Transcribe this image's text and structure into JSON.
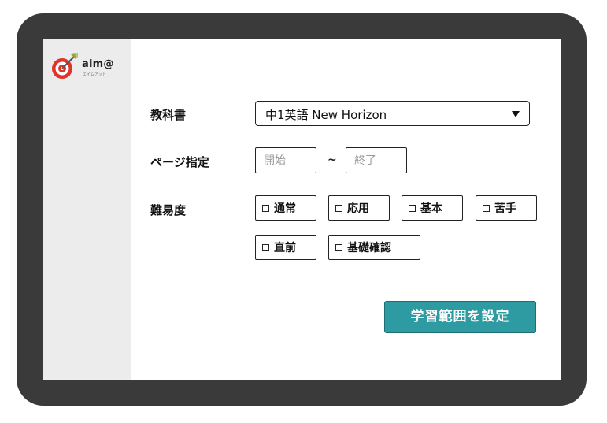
{
  "brand": {
    "name": "aim@",
    "subtitle": "エイムアット",
    "accent_color": "#e2322a",
    "logo_icon": "target-arrow-icon"
  },
  "form": {
    "textbook": {
      "label": "教科書",
      "selected": "中1英語 New Horizon",
      "icon": "dropdown-arrow-icon"
    },
    "pages": {
      "label": "ページ指定",
      "start_placeholder": "開始",
      "separator": "~",
      "end_placeholder": "終了"
    },
    "difficulty": {
      "label": "難易度",
      "options": [
        {
          "label": "通常"
        },
        {
          "label": "応用"
        },
        {
          "label": "基本"
        },
        {
          "label": "苦手"
        },
        {
          "label": "直前"
        },
        {
          "label": "基礎確認"
        }
      ]
    },
    "submit": {
      "label": "学習範囲を設定",
      "color": "#2e9aa1"
    }
  }
}
